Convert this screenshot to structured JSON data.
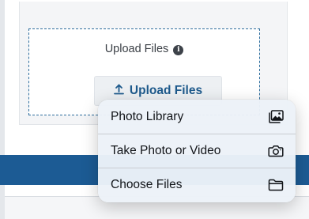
{
  "dropzone": {
    "label": "Upload Files",
    "info_icon": "info-icon"
  },
  "upload_button": {
    "label": "Upload Files",
    "icon": "upload-icon"
  },
  "menu": {
    "items": [
      {
        "label": "Photo Library",
        "icon": "photo-library-icon"
      },
      {
        "label": "Take Photo or Video",
        "icon": "camera-icon"
      },
      {
        "label": "Choose Files",
        "icon": "folder-icon"
      }
    ]
  },
  "colors": {
    "accent": "#1e5a8c",
    "bar": "#1c5b94",
    "dash": "#2f6e9e"
  }
}
